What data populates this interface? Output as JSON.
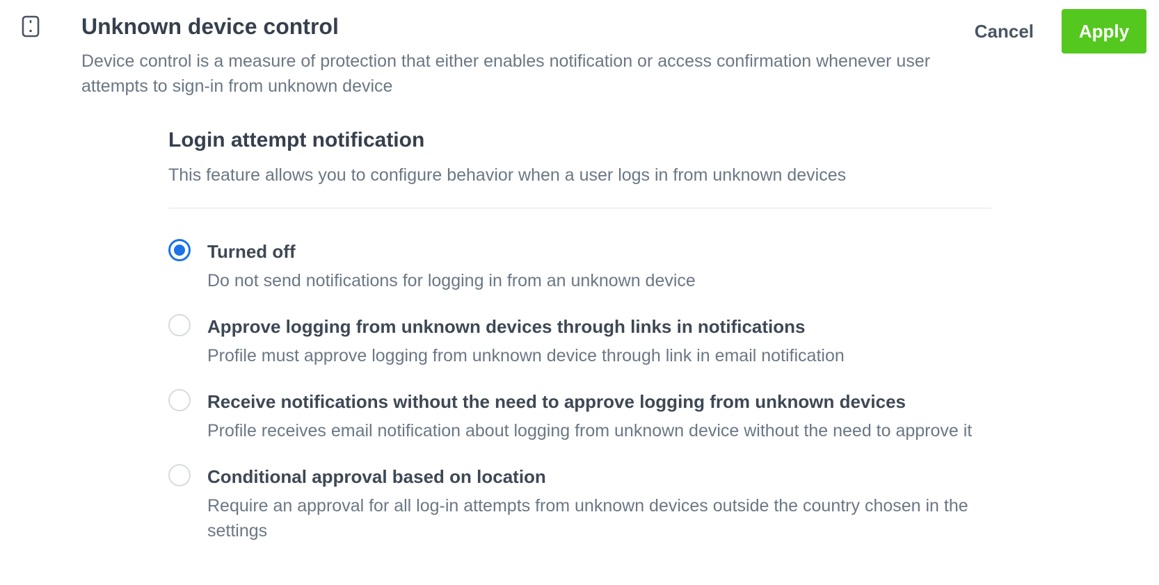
{
  "header": {
    "title": "Unknown device control",
    "description": "Device control is a measure of protection that either enables notification or access confirmation whenever user attempts to sign-in from unknown device",
    "icon": "device-icon",
    "cancel_label": "Cancel",
    "apply_label": "Apply",
    "apply_color": "#54c81e"
  },
  "section": {
    "title": "Login attempt notification",
    "description": "This feature allows you to configure behavior when a user logs in from unknown devices"
  },
  "options": [
    {
      "label": "Turned off",
      "description": "Do not send notifications for logging in from an unknown device",
      "selected": true
    },
    {
      "label": "Approve logging from unknown devices through links in notifications",
      "description": "Profile must approve logging from unknown device through link in email notification",
      "selected": false
    },
    {
      "label": "Receive notifications without the need to approve logging from unknown devices",
      "description": "Profile receives email notification about logging from unknown device without the need to approve it",
      "selected": false
    },
    {
      "label": "Conditional approval based on location",
      "description": "Require an approval for all log-in attempts from unknown devices outside the country chosen in the settings",
      "selected": false
    }
  ],
  "colors": {
    "radio_selected": "#1a73e8",
    "radio_unselected_border": "#d6dbe0"
  }
}
